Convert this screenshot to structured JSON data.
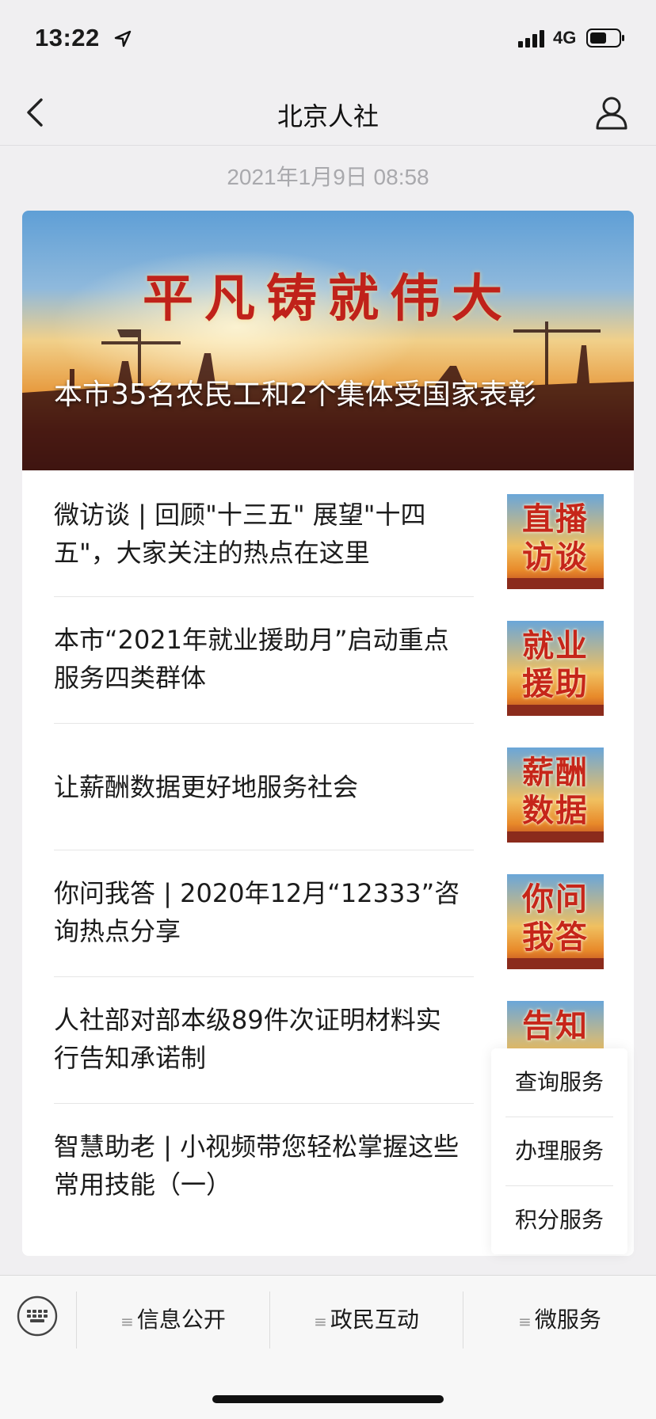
{
  "status_bar": {
    "time": "13:22",
    "network": "4G"
  },
  "nav": {
    "title": "北京人社"
  },
  "post": {
    "date": "2021年1月9日 08:58"
  },
  "banner": {
    "slogan": "平凡铸就伟大",
    "title": "本市35名农民工和2个集体受国家表彰"
  },
  "news": [
    {
      "title": "微访谈 | 回顾\"十三五\" 展望\"十四五\"，大家关注的热点在这里",
      "thumb_line1": "直播",
      "thumb_line2": "访谈"
    },
    {
      "title": "本市“2021年就业援助月”启动重点服务四类群体",
      "thumb_line1": "就业",
      "thumb_line2": "援助"
    },
    {
      "title": "让薪酬数据更好地服务社会",
      "thumb_line1": "薪酬",
      "thumb_line2": "数据"
    },
    {
      "title": "你问我答 | 2020年12月“12333”咨询热点分享",
      "thumb_line1": "你问",
      "thumb_line2": "我答"
    },
    {
      "title": "人社部对部本级89件次证明材料实行告知承诺制",
      "thumb_line1": "告知",
      "thumb_line2": ""
    },
    {
      "title": "智慧助老 | 小视频带您轻松掌握这些常用技能（一）"
    }
  ],
  "popup_menu": [
    "查询服务",
    "办理服务",
    "积分服务"
  ],
  "tabbar": {
    "menu_glyph": "≡",
    "tabs": [
      "信息公开",
      "政民互动",
      "微服务"
    ]
  }
}
